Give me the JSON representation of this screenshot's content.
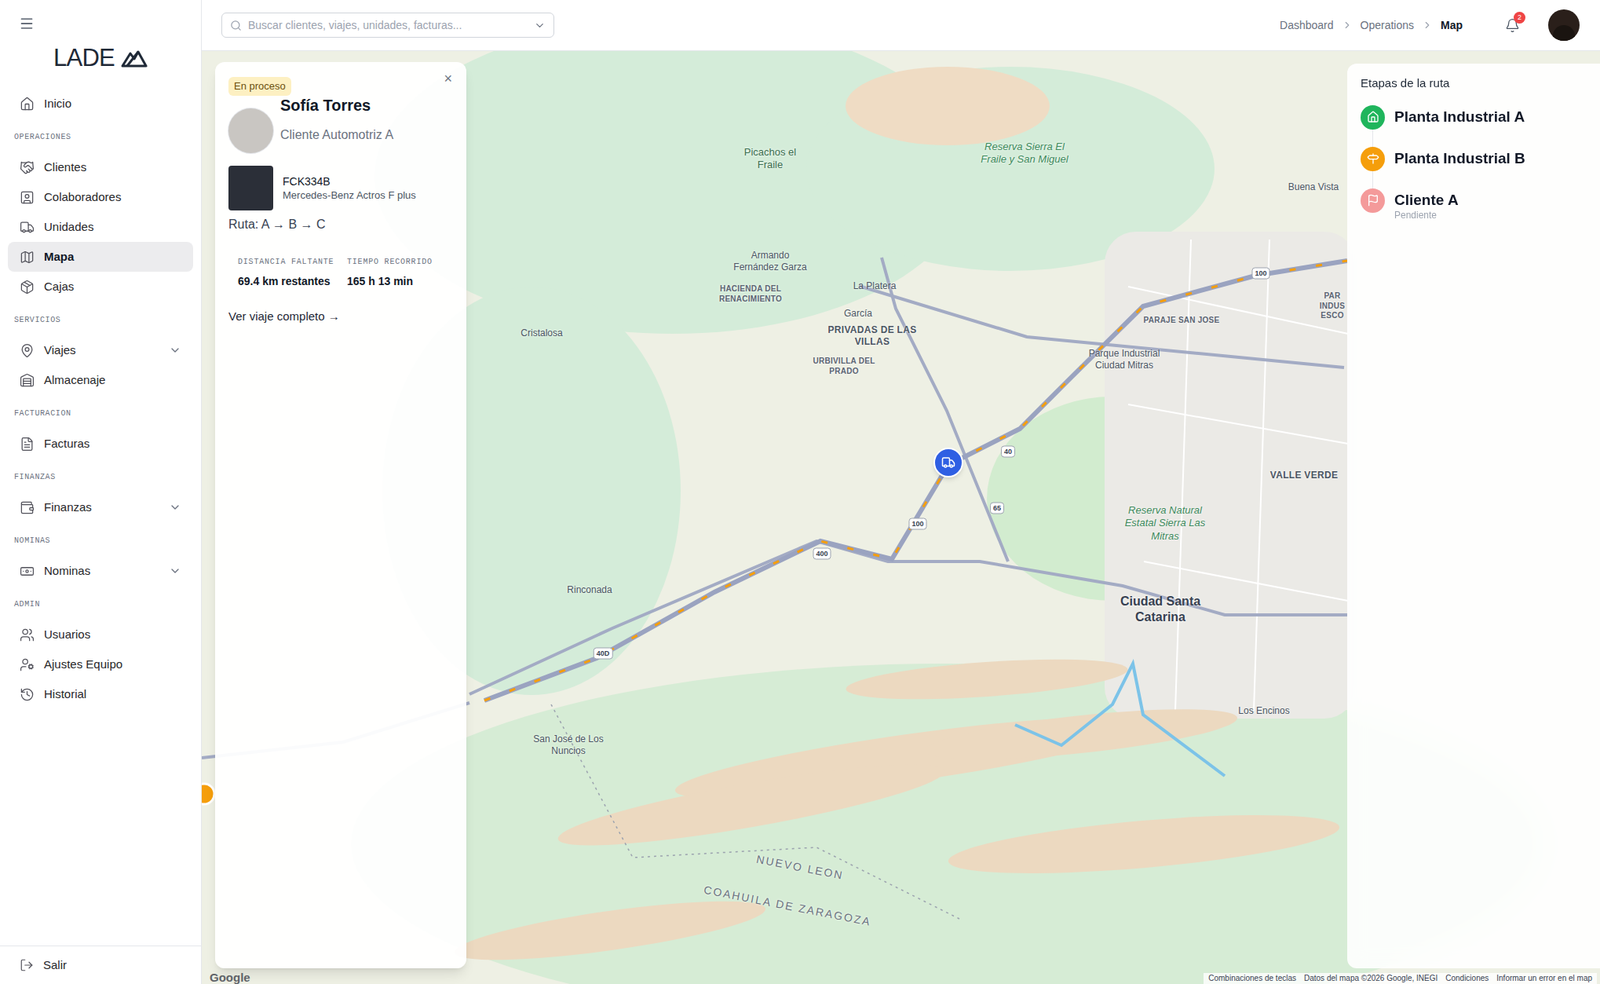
{
  "sidebar": {
    "logo": "LADE",
    "home": {
      "label": "Inicio",
      "selected": false,
      "expandable": false
    },
    "sections": [
      {
        "title": "OPERACIONES",
        "items": [
          {
            "label": "Clientes",
            "selected": false,
            "expandable": false
          },
          {
            "label": "Colaboradores",
            "selected": false,
            "expandable": false
          },
          {
            "label": "Unidades",
            "selected": false,
            "expandable": false
          },
          {
            "label": "Mapa",
            "selected": true,
            "expandable": false
          },
          {
            "label": "Cajas",
            "selected": false,
            "expandable": false
          }
        ]
      },
      {
        "title": "SERVICIOS",
        "items": [
          {
            "label": "Viajes",
            "selected": false,
            "expandable": true
          },
          {
            "label": "Almacenaje",
            "selected": false,
            "expandable": false
          }
        ]
      },
      {
        "title": "FACTURACION",
        "items": [
          {
            "label": "Facturas",
            "selected": false,
            "expandable": false
          }
        ]
      },
      {
        "title": "FINANZAS",
        "items": [
          {
            "label": "Finanzas",
            "selected": false,
            "expandable": true
          }
        ]
      },
      {
        "title": "NOMINAS",
        "items": [
          {
            "label": "Nominas",
            "selected": false,
            "expandable": true
          }
        ]
      },
      {
        "title": "ADMIN",
        "items": [
          {
            "label": "Usuarios",
            "selected": false,
            "expandable": false
          },
          {
            "label": "Ajustes Equipo",
            "selected": false,
            "expandable": false
          },
          {
            "label": "Historial",
            "selected": false,
            "expandable": false
          }
        ]
      }
    ],
    "logout": "Salir"
  },
  "topbar": {
    "search": {
      "placeholder": "Buscar clientes, viajes, unidades, facturas..."
    },
    "breadcrumbs": [
      {
        "label": "Dashboard",
        "selected": false
      },
      {
        "label": "Operations",
        "selected": false
      },
      {
        "label": "Map",
        "selected": true
      }
    ],
    "notifications": "2"
  },
  "trip_card": {
    "status": "En proceso",
    "close": "×",
    "driver": "Sofía Torres",
    "client": "Cliente Automotriz A",
    "unit": {
      "plate": "FCK334B",
      "model": "Mercedes-Benz Actros F plus"
    },
    "route": "Ruta: A → B → C",
    "stats": [
      {
        "label": "DISTANCIA FALTANTE",
        "value": "69.4 km restantes"
      },
      {
        "label": "TIEMPO RECORRIDO",
        "value": "165 h 13 min"
      }
    ],
    "link": "Ver viaje completo →"
  },
  "route_panel": {
    "title": "Etapas de la ruta",
    "stages": [
      {
        "name": "Planta Industrial A",
        "status": "",
        "kind": "origin",
        "color": "#1fb55c"
      },
      {
        "name": "Planta Industrial B",
        "status": "",
        "kind": "stop",
        "color": "#f59e0b"
      },
      {
        "name": "Cliente A",
        "status": "Pendiente",
        "kind": "destination",
        "color": "#f49a9a"
      }
    ]
  },
  "map": {
    "labels": [
      {
        "text": "Picachos el Fraile",
        "kind": "poi"
      },
      {
        "text": "Reserva Sierra El Fraile y San Miguel",
        "kind": "park"
      },
      {
        "text": "Buena Vista",
        "kind": "place"
      },
      {
        "text": "Armando Fernández Garza",
        "kind": "place"
      },
      {
        "text": "HACIENDA DEL RENACIMIENTO",
        "kind": "district"
      },
      {
        "text": "La Platera",
        "kind": "place"
      },
      {
        "text": "García",
        "kind": "place"
      },
      {
        "text": "PRIVADAS DE LAS VILLAS",
        "kind": "district_large"
      },
      {
        "text": "URBIVILLA DEL PRADO",
        "kind": "district"
      },
      {
        "text": "Cristalosa",
        "kind": "place"
      },
      {
        "text": "PARAJE SAN JOSE",
        "kind": "district"
      },
      {
        "text": "Parque Industrial Ciudad Mitras",
        "kind": "place"
      },
      {
        "text": "VALLE VERDE",
        "kind": "district_large"
      },
      {
        "text": "Reserva Natural Estatal Sierra Las Mitras",
        "kind": "park"
      },
      {
        "text": "Rinconada",
        "kind": "place"
      },
      {
        "text": "Ciudad Santa Catarina",
        "kind": "city"
      },
      {
        "text": "San José de Los Nuncios",
        "kind": "place"
      },
      {
        "text": "Los Encinos",
        "kind": "place"
      },
      {
        "text": "NUEVO LEON",
        "kind": "state"
      },
      {
        "text": "COAHUILA DE ZARAGOZA",
        "kind": "state"
      },
      {
        "text": "PAR INDUS ESCO",
        "kind": "district"
      }
    ],
    "shields": [
      "100",
      "40",
      "65",
      "100",
      "400",
      "40D"
    ],
    "attribution": "Google",
    "footer": [
      "Combinaciones de teclas",
      "Datos del mapa ©2026 Google, INEGI",
      "Condiciones",
      "Informar un error en el map"
    ]
  }
}
